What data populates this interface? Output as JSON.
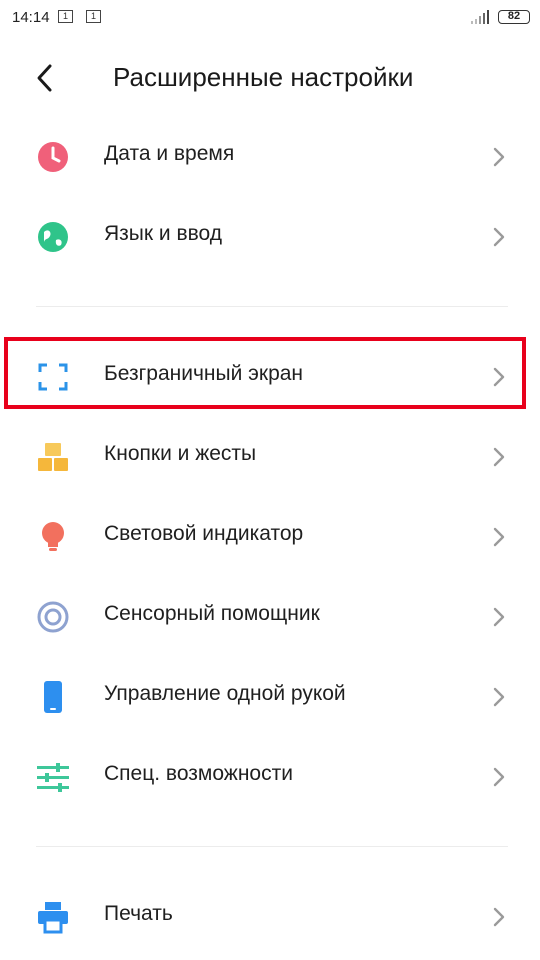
{
  "status_bar": {
    "time": "14:14",
    "sim1": "1",
    "sim2": "1",
    "battery": "82"
  },
  "header": {
    "title": "Расширенные настройки",
    "back_icon": "chevron-left-icon"
  },
  "items": [
    {
      "label": "Дата и время",
      "icon": "clock-icon",
      "color": "#f0607a"
    },
    {
      "label": "Язык и ввод",
      "icon": "globe-icon",
      "color": "#2fc48a"
    },
    {
      "label": "Безграничный экран",
      "icon": "fullscreen-icon",
      "color": "#2b93e8",
      "highlighted": true
    },
    {
      "label": "Кнопки и жесты",
      "icon": "buttons-icon",
      "color": "#f5b73b"
    },
    {
      "label": "Световой индикатор",
      "icon": "bulb-icon",
      "color": "#f2705e"
    },
    {
      "label": "Сенсорный помощник",
      "icon": "target-icon",
      "color": "#8ea2d0"
    },
    {
      "label": "Управление одной рукой",
      "icon": "phone-icon",
      "color": "#2d8fef"
    },
    {
      "label": "Спец. возможности",
      "icon": "sliders-icon",
      "color": "#3ec79a"
    },
    {
      "label": "Печать",
      "icon": "printer-icon",
      "color": "#2d8fef"
    }
  ],
  "colors": {
    "highlight": "#e8001b",
    "chevron": "#9a9a9a",
    "divider": "#ececec"
  }
}
